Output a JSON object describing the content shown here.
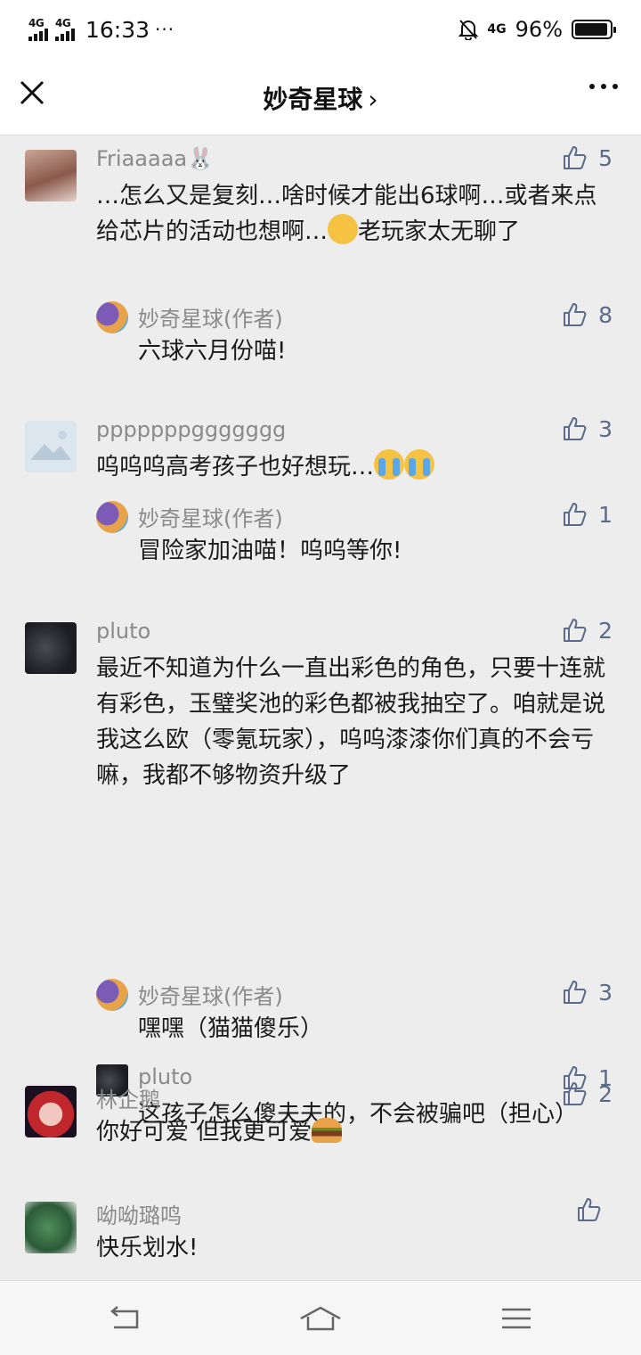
{
  "status_bar": {
    "network_1": "4G",
    "network_2": "4G",
    "time": "16:33",
    "dots": "···",
    "signal_right": "4G",
    "battery_percent": "96%",
    "battery_level": 0.96
  },
  "nav": {
    "title": "妙奇星球",
    "title_chevron": "›"
  },
  "comments": [
    {
      "user": "Friaaaaa🐰",
      "likes": "5",
      "text_a": "…怎么又是复刻…啥时候才能出6球啊…或者来点给芯片的活动也想啊…",
      "text_b": "老玩家太无聊了",
      "replies": [
        {
          "user": "妙奇星球(作者)",
          "likes": "8",
          "text": "六球六月份喵!"
        }
      ]
    },
    {
      "user": "pppppppggggggg",
      "likes": "3",
      "text_a": "呜呜呜高考孩子也好想玩…",
      "text_b": "",
      "replies": [
        {
          "user": "妙奇星球(作者)",
          "likes": "1",
          "text": "冒险家加油喵！呜呜等你!"
        }
      ]
    },
    {
      "user": "pluto",
      "likes": "2",
      "text_a": "最近不知道为什么一直出彩色的角色，只要十连就有彩色，玉璧奖池的彩色都被我抽空了。咱就是说我这么欧（零氪玩家），呜呜漆漆你们真的不会亏嘛，我都不够物资升级了",
      "text_b": "",
      "replies": [
        {
          "user": "妙奇星球(作者)",
          "likes": "3",
          "text": "嘿嘿（猫猫傻乐）"
        },
        {
          "user": "pluto",
          "likes": "1",
          "text": "这孩子怎么傻夫夫的，不会被骗吧（担心）"
        }
      ]
    },
    {
      "user": "林企鹅",
      "likes": "2",
      "text_a": "你好可爱 但我更可爱",
      "text_b": "",
      "replies": []
    },
    {
      "user": "呦呦璐鸣",
      "likes": "",
      "text_a": "快乐划水!",
      "text_b": "",
      "replies": []
    }
  ]
}
